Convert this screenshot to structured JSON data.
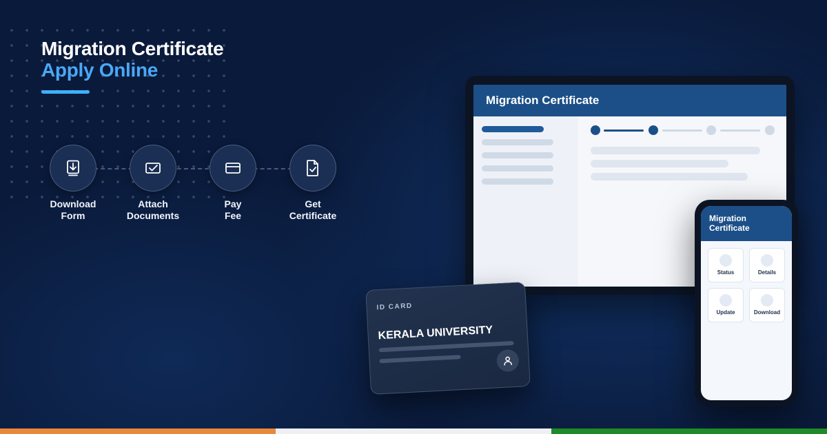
{
  "hero": {
    "title_line1": "Migration Certificate",
    "title_line2": "Apply Online"
  },
  "steps": [
    {
      "line1": "Download",
      "line2": "Form",
      "icon": "download-form-icon"
    },
    {
      "line1": "Attach",
      "line2": "Documents",
      "icon": "attach-check-icon"
    },
    {
      "line1": "Pay",
      "line2": "Fee",
      "icon": "credit-card-icon"
    },
    {
      "line1": "Get",
      "line2": "Certificate",
      "icon": "certificate-check-icon"
    }
  ],
  "tablet": {
    "header": "Migration Certificate"
  },
  "phone": {
    "header": "Migration Certificate",
    "tiles": [
      "Status",
      "Details",
      "Update",
      "Download"
    ]
  },
  "id_card": {
    "label": "ID CARD",
    "university": "KERALA UNIVERSITY"
  },
  "colors": {
    "background": "#0a1a3a",
    "accent": "#4aa8f7",
    "header_blue": "#1c4f87",
    "flag": [
      "#e8883a",
      "#eef0f4",
      "#1f8a2a"
    ]
  }
}
